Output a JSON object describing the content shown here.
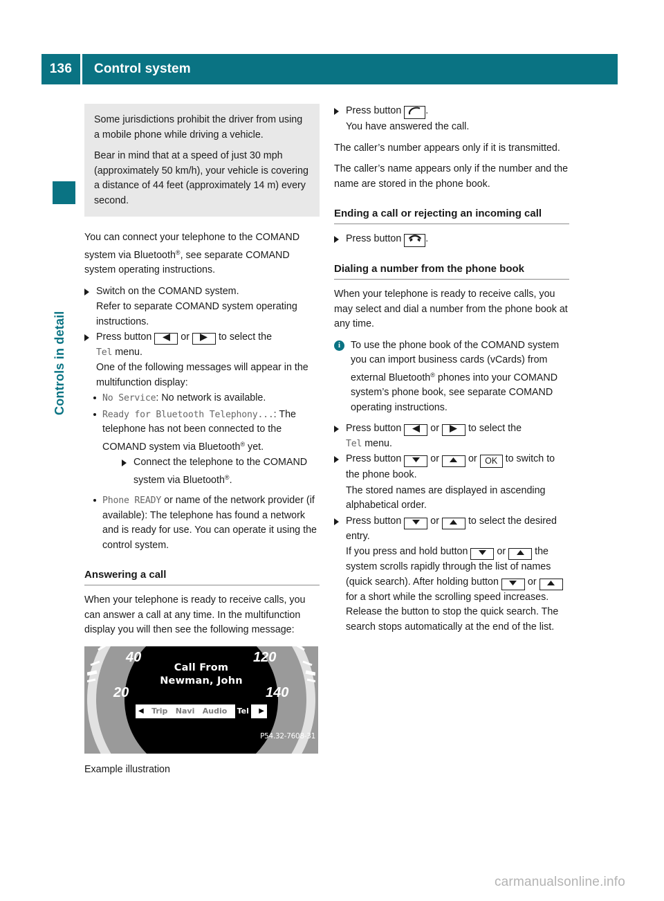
{
  "header": {
    "page_number": "136",
    "title": "Control system",
    "accent_color": "#0a7383"
  },
  "side_tab": {
    "label": "Controls in detail"
  },
  "left_column": {
    "warning_box": {
      "paragraph_1": "Some jurisdictions prohibit the driver from using a mobile phone while driving a vehicle.",
      "paragraph_2": "Bear in mind that at a speed of just 30 mph (approximately 50 km/h), your vehicle is covering a distance of 44 feet (approximately 14 m) every second."
    },
    "intro_paragraph_pre": "You can connect your telephone to the COMAND system via Bluetooth",
    "intro_paragraph_post": ", see separate COMAND system operating instructions.",
    "step_switch_on": "Switch on the COMAND system.",
    "step_switch_on_sub": "Refer to separate COMAND system operating instructions.",
    "step_press_pre": "Press button",
    "step_press_or": "or",
    "step_press_post": "to select the",
    "tel_menu_mono": "Tel",
    "tel_menu_word": "menu.",
    "messages_intro": "One of the following messages will appear in the multifunction display:",
    "bullets": [
      {
        "mono": "No Service",
        "text": ": No network is available."
      },
      {
        "mono": "Ready for Bluetooth Telephony...",
        "text": ":",
        "body_pre": "The telephone has not been connected to the COMAND system via Bluetooth",
        "body_post": " yet.",
        "substep_pre": "Connect the telephone to the COMAND system via Bluetooth",
        "substep_post": "."
      },
      {
        "mono": "Phone READY",
        "text": " or name of the network provider (if available): The telephone has found a network and is ready for use. You can operate it using the control system."
      }
    ],
    "answering_heading": "Answering a call",
    "answering_body": "When your telephone is ready to receive calls, you can answer a call at any time. In the multifunction display you will then see the following message:",
    "figure": {
      "dial_numbers": [
        "40",
        "20",
        "120",
        "140"
      ],
      "call_line_1": "Call From",
      "call_line_2": "Newman, John",
      "menu_items": [
        "Trip",
        "Navi",
        "Audio",
        "Tel"
      ],
      "active_menu_item": "Tel",
      "left_arrow": "◀",
      "right_arrow": "▶",
      "figure_code": "P54.32-7608-31",
      "caption": "Example illustration"
    }
  },
  "right_column": {
    "step_press_accept_pre": "Press button",
    "step_press_accept_post": ".",
    "step_accept_sub": "You have answered the call.",
    "caller_number_paragraph": "The caller’s number appears only if it is transmitted.",
    "caller_name_paragraph": "The caller’s name appears only if the number and the name are stored in the phone book.",
    "ending_heading": "Ending a call or rejecting an incoming call",
    "step_press_end_pre": "Press button",
    "step_press_end_post": ".",
    "dialing_heading": "Dialing a number from the phone book",
    "dialing_body": "When your telephone is ready to receive calls, you may select and dial a number from the phone book at any time.",
    "info_note_pre": "To use the phone book of the COMAND system you can import business cards (vCards) from external Bluetooth",
    "info_note_post": " phones into your COMAND system’s phone book, see separate COMAND operating instructions.",
    "step_tel_pre": "Press button",
    "step_tel_or": "or",
    "step_tel_post": "to select the",
    "tel_menu_mono": "Tel",
    "tel_menu_word": "menu.",
    "step_phonebook_pre": "Press button",
    "step_phonebook_or1": "or",
    "step_phonebook_or2": "or",
    "ok_label": "OK",
    "step_phonebook_post": "to switch to the phone book.",
    "step_phonebook_sub": "The stored names are displayed in ascending alphabetical order.",
    "step_entry_pre": "Press button",
    "step_entry_or": "or",
    "step_entry_post": "to select the desired entry.",
    "quick_search_1": "If you press and hold button",
    "quick_search_or1": "or",
    "quick_search_2": "the system scrolls rapidly through the list of names (quick search). After holding button",
    "quick_search_or2": "or",
    "quick_search_3": "for a short while the scrolling speed increases. Release the button to stop the quick search. The search stops automatically at the end of the list."
  },
  "watermark": "carmanualsonline.info"
}
